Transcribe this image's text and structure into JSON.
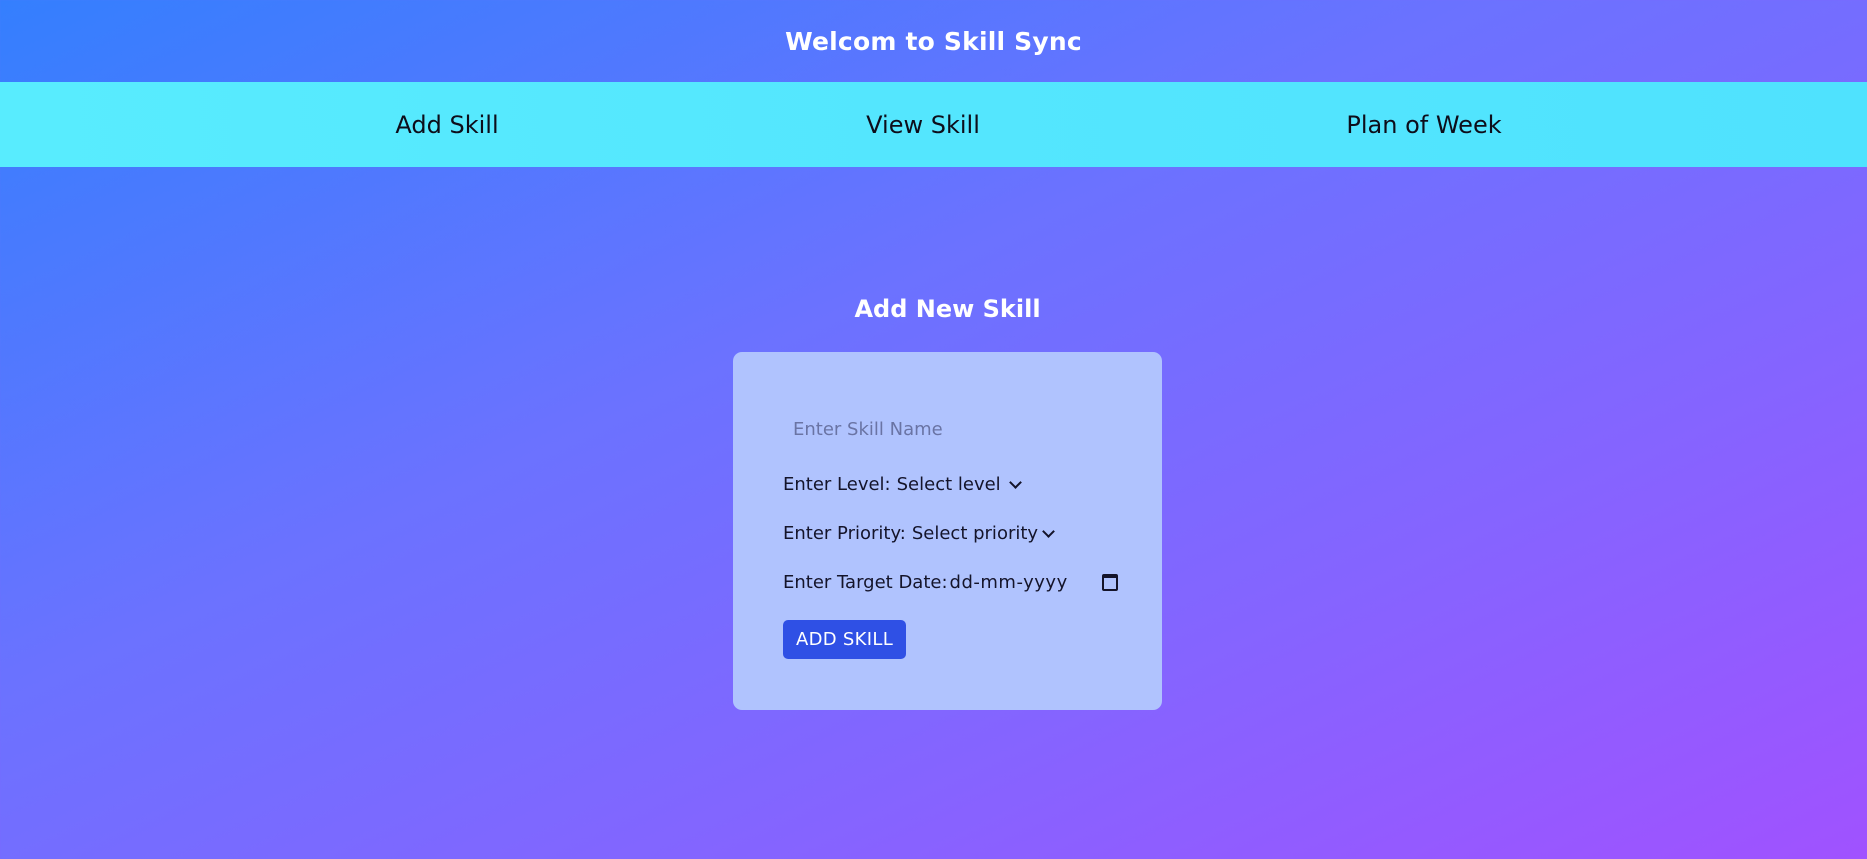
{
  "header": {
    "title": "Welcom to Skill Sync"
  },
  "nav": {
    "items": [
      {
        "label": "Add Skill"
      },
      {
        "label": "View Skill"
      },
      {
        "label": "Plan of Week"
      }
    ]
  },
  "form": {
    "section_title": "Add New Skill",
    "skill_name": {
      "placeholder": "Enter Skill Name",
      "value": ""
    },
    "level": {
      "label": "Enter Level:",
      "selected": "Select level"
    },
    "priority": {
      "label": "Enter Priority:",
      "selected": "Select priority"
    },
    "target_date": {
      "label": "Enter Target Date:",
      "value": "dd-mm-yyyy"
    },
    "submit_label": "ADD SKILL"
  },
  "colors": {
    "gradient_start": "#347ffe",
    "gradient_end": "#a052ff",
    "navbar": "#54e6fe",
    "card": "#b0c3fe",
    "button": "#2f50e5"
  }
}
